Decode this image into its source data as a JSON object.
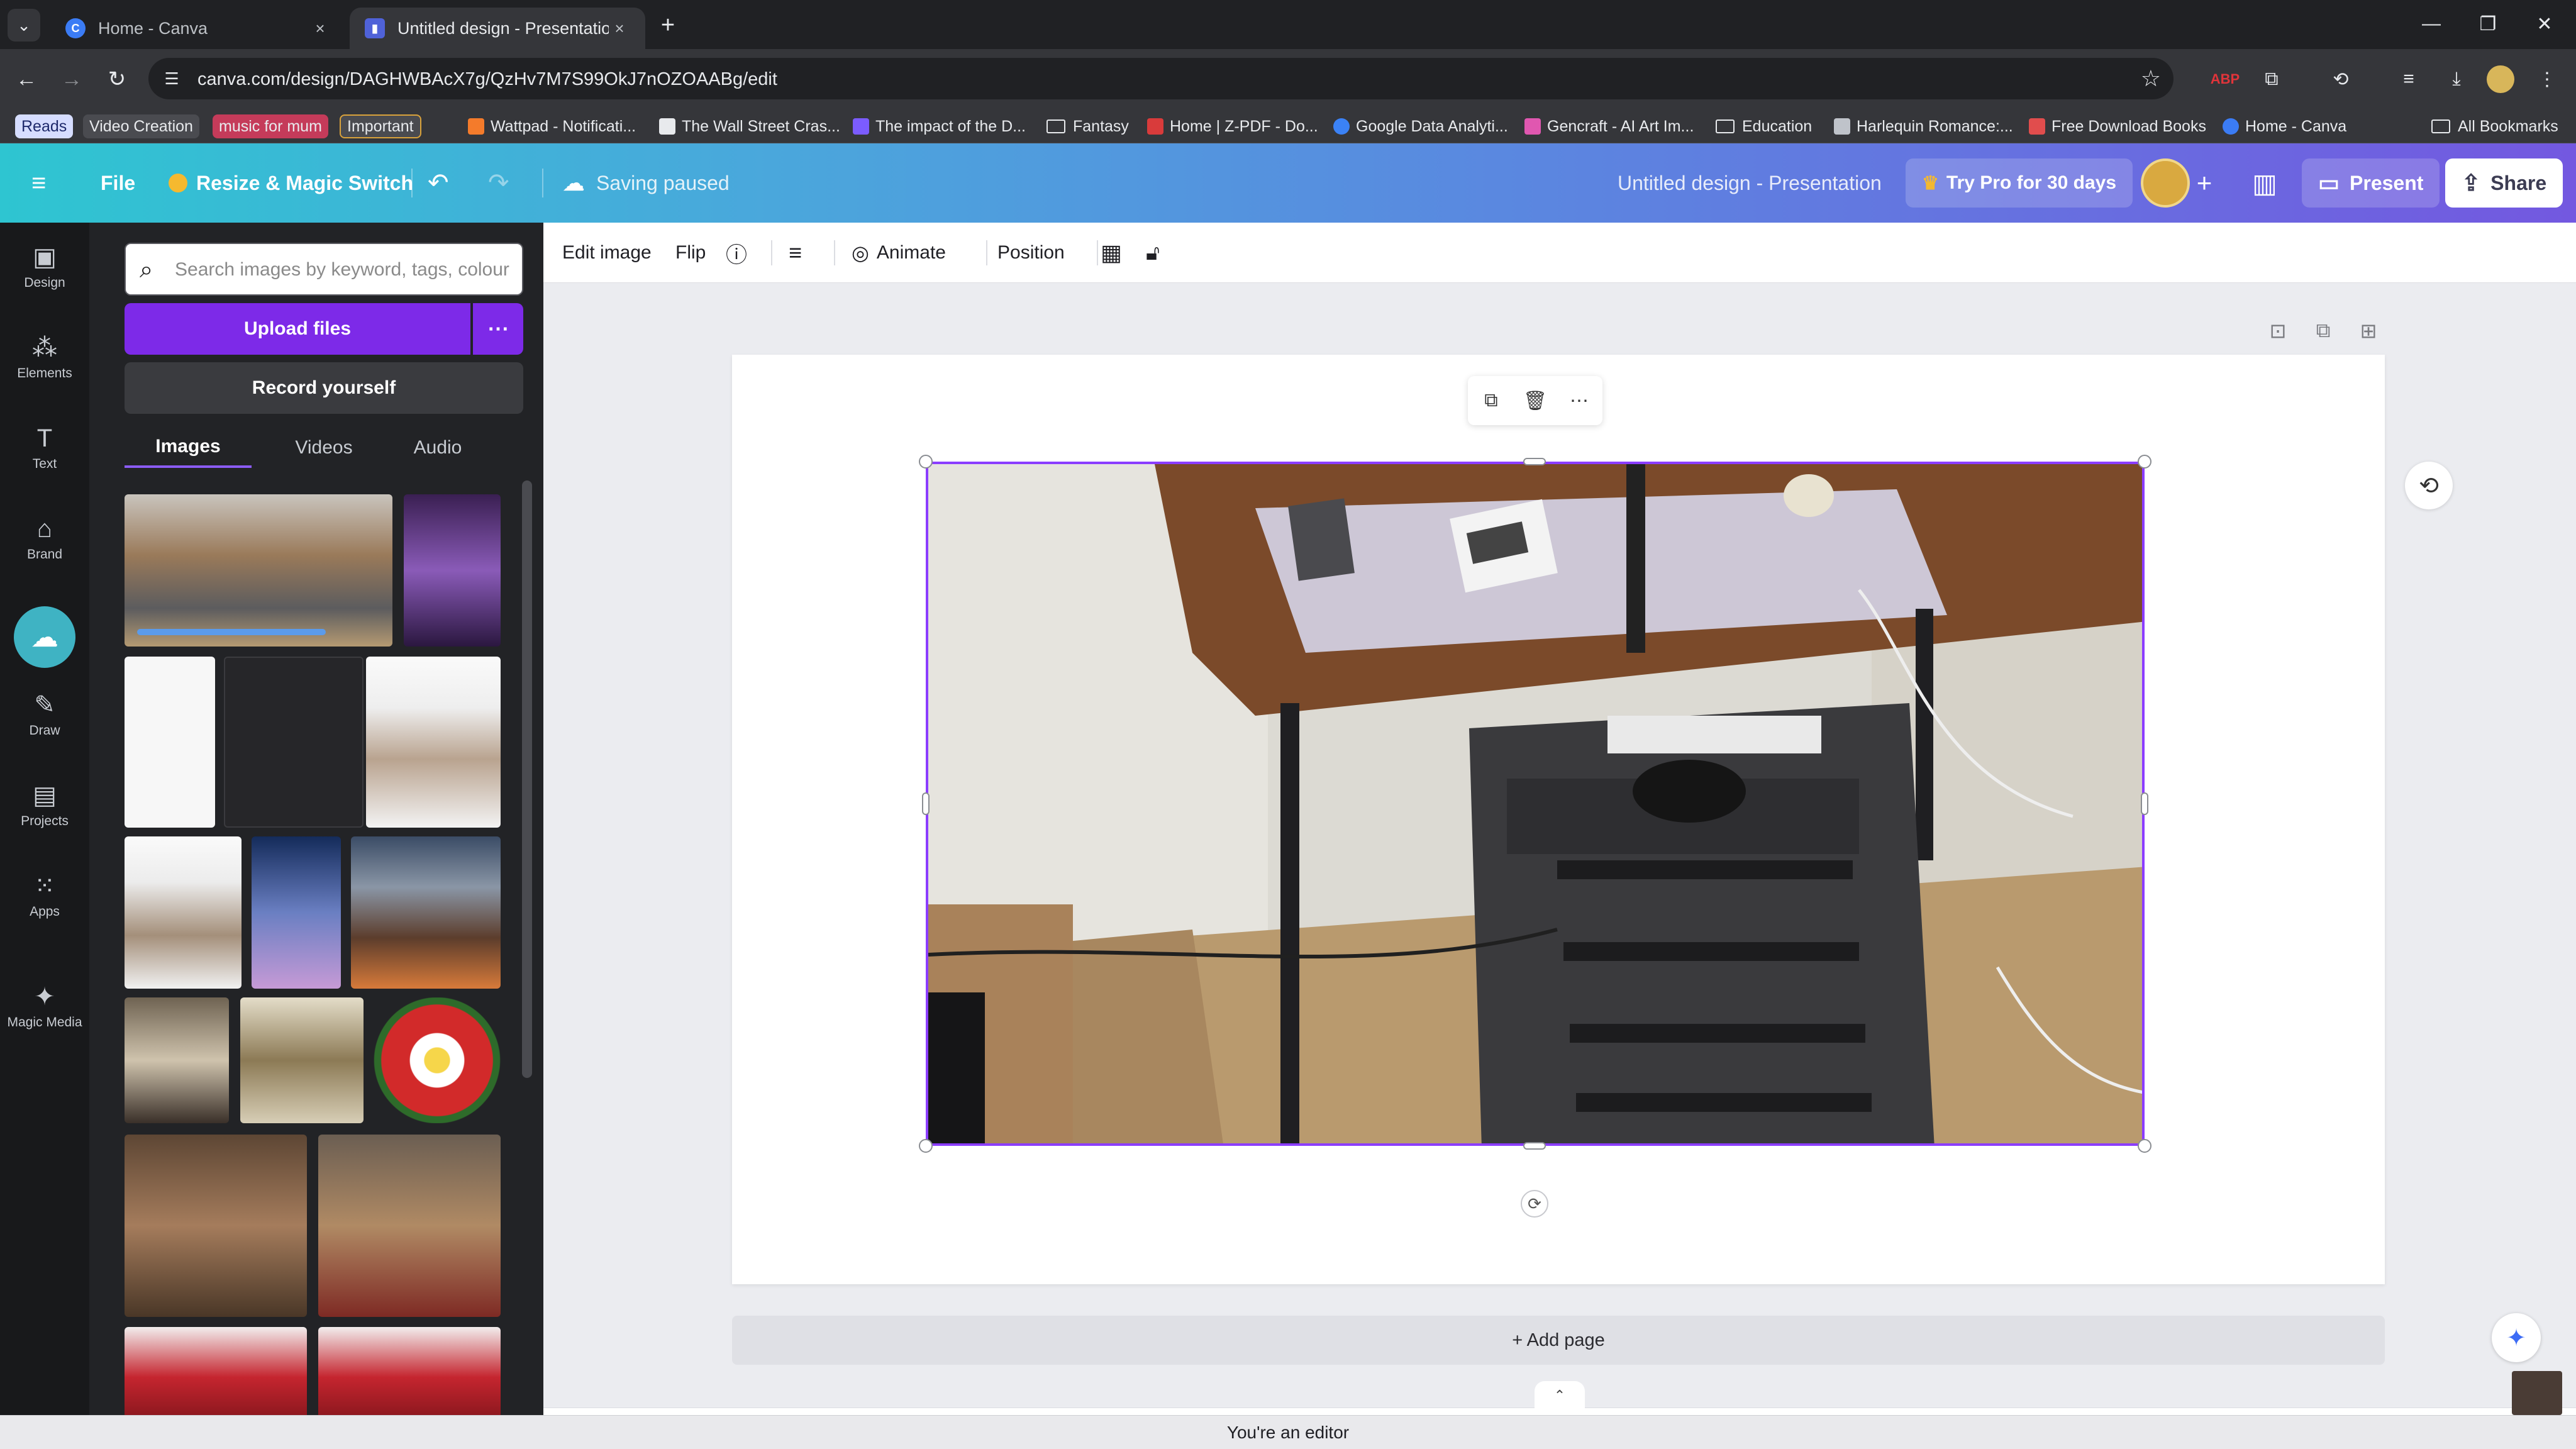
{
  "browser": {
    "tabs": [
      {
        "title": "Home - Canva",
        "active": false
      },
      {
        "title": "Untitled design - Presentation",
        "active": true
      }
    ],
    "url": "canva.com/design/DAGHWBAcX7g/QzHv7M7S99OkJ7nOZOAABg/edit",
    "bookmarks": [
      "Reads",
      "Video Creation",
      "music for mum",
      "Important",
      "Wattpad - Notificati...",
      "The Wall Street Cras...",
      "The impact of the D...",
      "Fantasy",
      "Home | Z-PDF - Do...",
      "Google Data Analyti...",
      "Gencraft - AI Art Im...",
      "Education",
      "Harlequin Romance:...",
      "Free Download Books",
      "Home - Canva",
      "All Bookmarks"
    ]
  },
  "header": {
    "file_label": "File",
    "resize_label": "Resize & Magic Switch",
    "saving_status": "Saving paused",
    "design_title": "Untitled design - Presentation",
    "pro_label": "Try Pro for 30 days",
    "present_label": "Present",
    "share_label": "Share"
  },
  "rail": [
    {
      "label": "Design",
      "icon": "design-icon"
    },
    {
      "label": "Elements",
      "icon": "elements-icon"
    },
    {
      "label": "Text",
      "icon": "text-icon"
    },
    {
      "label": "Brand",
      "icon": "brand-icon"
    },
    {
      "label": "Draw",
      "icon": "draw-icon"
    },
    {
      "label": "Projects",
      "icon": "projects-icon"
    },
    {
      "label": "Apps",
      "icon": "apps-icon"
    },
    {
      "label": "Magic Media",
      "icon": "magic-media-icon"
    }
  ],
  "panel": {
    "search_placeholder": "Search images by keyword, tags, colour",
    "upload_label": "Upload files",
    "record_label": "Record yourself",
    "tabs": [
      "Images",
      "Videos",
      "Audio"
    ]
  },
  "context_toolbar": {
    "edit_image": "Edit image",
    "flip": "Flip",
    "animate": "Animate",
    "position": "Position"
  },
  "canvas": {
    "add_page": "+ Add page"
  },
  "status": "You're an editor",
  "colors": {
    "canva_purple": "#7d2ae8",
    "selection": "#8b3dff",
    "header_start": "#2ec5d1",
    "header_end": "#7358e0"
  }
}
